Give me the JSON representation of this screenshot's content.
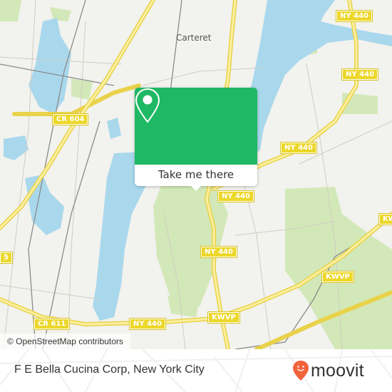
{
  "map": {
    "place_labels": [
      {
        "name": "Carteret"
      }
    ],
    "route_shields": [
      {
        "label": "CR 604"
      },
      {
        "label": "NY 440"
      },
      {
        "label": "NY 440"
      },
      {
        "label": "NY 440"
      },
      {
        "label": "NY 440"
      },
      {
        "label": "NY 440"
      },
      {
        "label": "KWVP"
      },
      {
        "label": "KWVP"
      },
      {
        "label": "KW"
      },
      {
        "label": "CR 611"
      },
      {
        "label": "NY 440"
      },
      {
        "label": "5"
      }
    ],
    "attribution": "© OpenStreetMap contributors",
    "colors": {
      "land": "#f2f2ee",
      "water": "#a9d8ec",
      "park": "#cfe6b0",
      "highway": "#f6e26a",
      "shield": "#ecd72a"
    }
  },
  "popup": {
    "icon": "location-pin-icon",
    "button_label": "Take me there",
    "color": "#1fb864"
  },
  "footer": {
    "title": "F E Bella Cucina Corp, New York City",
    "brand": "moovit",
    "brand_color": "#f0643c"
  }
}
